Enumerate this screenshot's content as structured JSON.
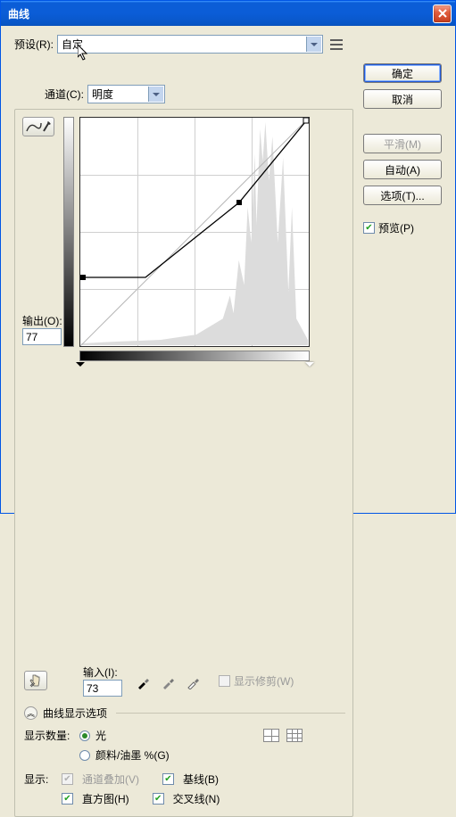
{
  "title": "曲线",
  "preset": {
    "label": "预设(R):",
    "value": "自定",
    "menu_icon": "options-menu-icon"
  },
  "channel": {
    "label": "通道(C):",
    "value": "明度"
  },
  "buttons": {
    "ok": "确定",
    "cancel": "取消",
    "smooth": "平滑(M)",
    "auto": "自动(A)",
    "options": "选项(T)..."
  },
  "preview": {
    "label": "预览(P)",
    "checked": true
  },
  "output": {
    "label": "输出(O):",
    "value": "77"
  },
  "input": {
    "label": "输入(I):",
    "value": "73"
  },
  "show_clipping": {
    "label": "显示修剪(W)",
    "checked": false
  },
  "display_options_header": "曲线显示选项",
  "display_amount": {
    "label": "显示数量:",
    "light": "光",
    "pigment": "颜料/油墨 %(G)"
  },
  "show": {
    "label": "显示:",
    "channel_overlay": "通道叠加(V)",
    "baseline": "基线(B)",
    "histogram": "直方图(H)",
    "intersection": "交叉线(N)"
  },
  "colors": {
    "accent": "#0b5dd7",
    "panel": "#ece9d8"
  },
  "chart_data": {
    "type": "line",
    "title": "曲线",
    "xlabel": "输入",
    "ylabel": "输出",
    "xlim": [
      0,
      255
    ],
    "ylim": [
      0,
      255
    ],
    "points": [
      {
        "x": 0,
        "y": 77
      },
      {
        "x": 73,
        "y": 77
      },
      {
        "x": 178,
        "y": 161
      },
      {
        "x": 255,
        "y": 255
      }
    ],
    "baseline": [
      {
        "x": 0,
        "y": 0
      },
      {
        "x": 255,
        "y": 255
      }
    ],
    "grid_divisions": 4,
    "histogram_visible": true
  }
}
